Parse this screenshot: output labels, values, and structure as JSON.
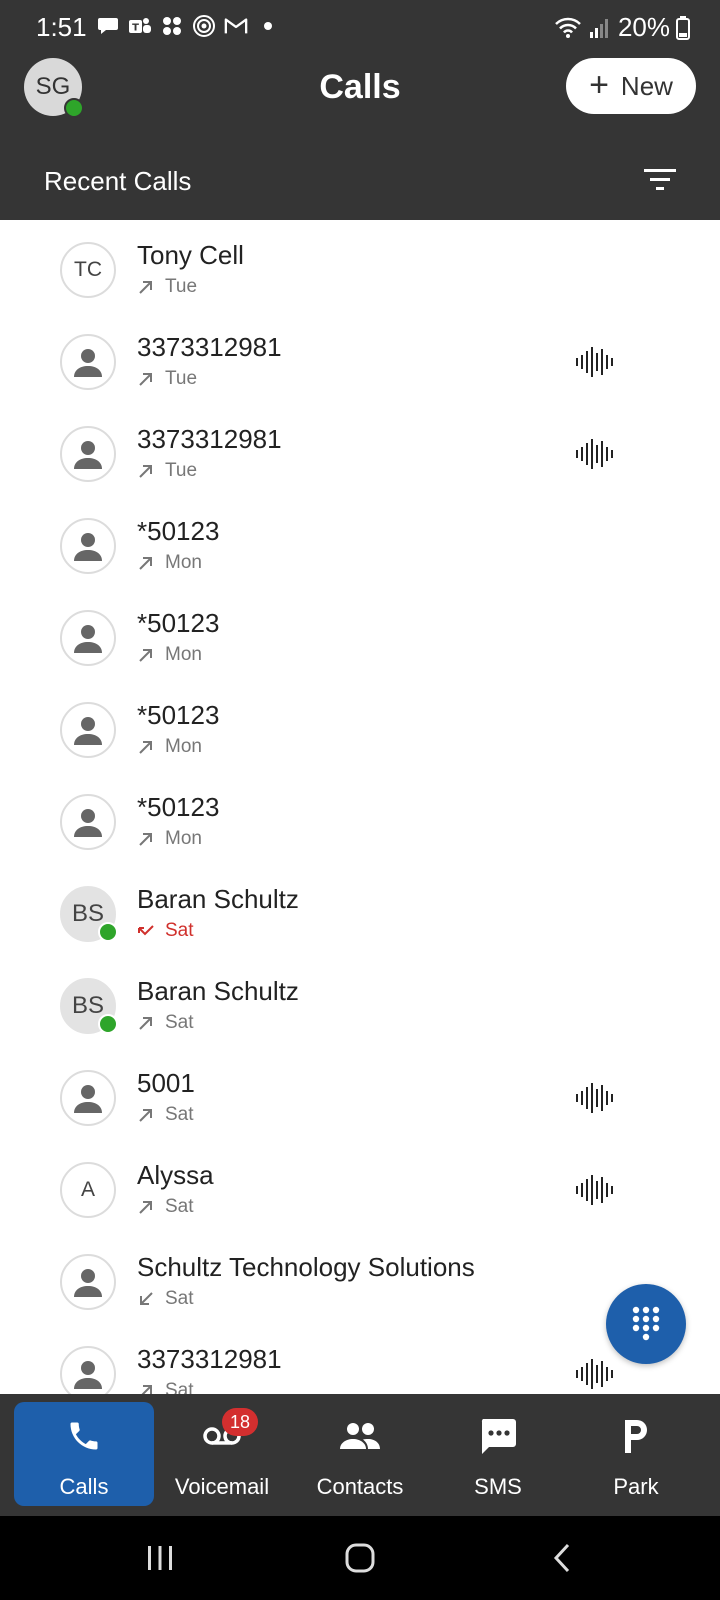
{
  "status_bar": {
    "time": "1:51",
    "battery": "20%",
    "left_icons": [
      "chat-bubble-icon",
      "teams-icon",
      "slack-icon",
      "signal-icon",
      "gmail-icon",
      "dot-icon"
    ],
    "right_icons": [
      "wifi-icon",
      "cell-signal-icon",
      "battery-icon"
    ]
  },
  "header": {
    "avatar_initials": "SG",
    "title": "Calls",
    "new_button_label": "New",
    "section_title": "Recent Calls"
  },
  "calls": [
    {
      "name": "Tony Cell",
      "day": "Tue",
      "direction": "outgoing",
      "avatar": "TC",
      "avatar_type": "initials",
      "presence": false,
      "voicemail_wave": false
    },
    {
      "name": "3373312981",
      "day": "Tue",
      "direction": "outgoing",
      "avatar": "",
      "avatar_type": "person",
      "presence": false,
      "voicemail_wave": true
    },
    {
      "name": "3373312981",
      "day": "Tue",
      "direction": "outgoing",
      "avatar": "",
      "avatar_type": "person",
      "presence": false,
      "voicemail_wave": true
    },
    {
      "name": "*50123",
      "day": "Mon",
      "direction": "outgoing",
      "avatar": "",
      "avatar_type": "person",
      "presence": false,
      "voicemail_wave": false
    },
    {
      "name": "*50123",
      "day": "Mon",
      "direction": "outgoing",
      "avatar": "",
      "avatar_type": "person",
      "presence": false,
      "voicemail_wave": false
    },
    {
      "name": "*50123",
      "day": "Mon",
      "direction": "outgoing",
      "avatar": "",
      "avatar_type": "person",
      "presence": false,
      "voicemail_wave": false
    },
    {
      "name": "*50123",
      "day": "Mon",
      "direction": "outgoing",
      "avatar": "",
      "avatar_type": "person",
      "presence": false,
      "voicemail_wave": false
    },
    {
      "name": "Baran Schultz",
      "day": "Sat",
      "direction": "missed",
      "avatar": "BS",
      "avatar_type": "initials-filled",
      "presence": true,
      "voicemail_wave": false
    },
    {
      "name": "Baran Schultz",
      "day": "Sat",
      "direction": "outgoing",
      "avatar": "BS",
      "avatar_type": "initials-filled",
      "presence": true,
      "voicemail_wave": false
    },
    {
      "name": "5001",
      "day": "Sat",
      "direction": "outgoing",
      "avatar": "",
      "avatar_type": "person",
      "presence": false,
      "voicemail_wave": true
    },
    {
      "name": "Alyssa",
      "day": "Sat",
      "direction": "outgoing",
      "avatar": "A",
      "avatar_type": "initials",
      "presence": false,
      "voicemail_wave": true
    },
    {
      "name": "Schultz Technology Solutions",
      "day": "Sat",
      "direction": "incoming",
      "avatar": "",
      "avatar_type": "person",
      "presence": false,
      "voicemail_wave": false
    },
    {
      "name": "3373312981",
      "day": "Sat",
      "direction": "outgoing",
      "avatar": "",
      "avatar_type": "person",
      "presence": false,
      "voicemail_wave": true
    }
  ],
  "bottom_nav": {
    "items": [
      {
        "label": "Calls",
        "icon": "phone-icon",
        "active": true
      },
      {
        "label": "Voicemail",
        "icon": "voicemail-icon",
        "badge": "18"
      },
      {
        "label": "Contacts",
        "icon": "contacts-icon"
      },
      {
        "label": "SMS",
        "icon": "sms-icon"
      },
      {
        "label": "Park",
        "icon": "park-icon"
      }
    ]
  },
  "colors": {
    "header_bg": "#353535",
    "accent": "#1e5fab",
    "presence": "#2ea52a",
    "missed": "#d0302c",
    "badge": "#d32f2f"
  }
}
